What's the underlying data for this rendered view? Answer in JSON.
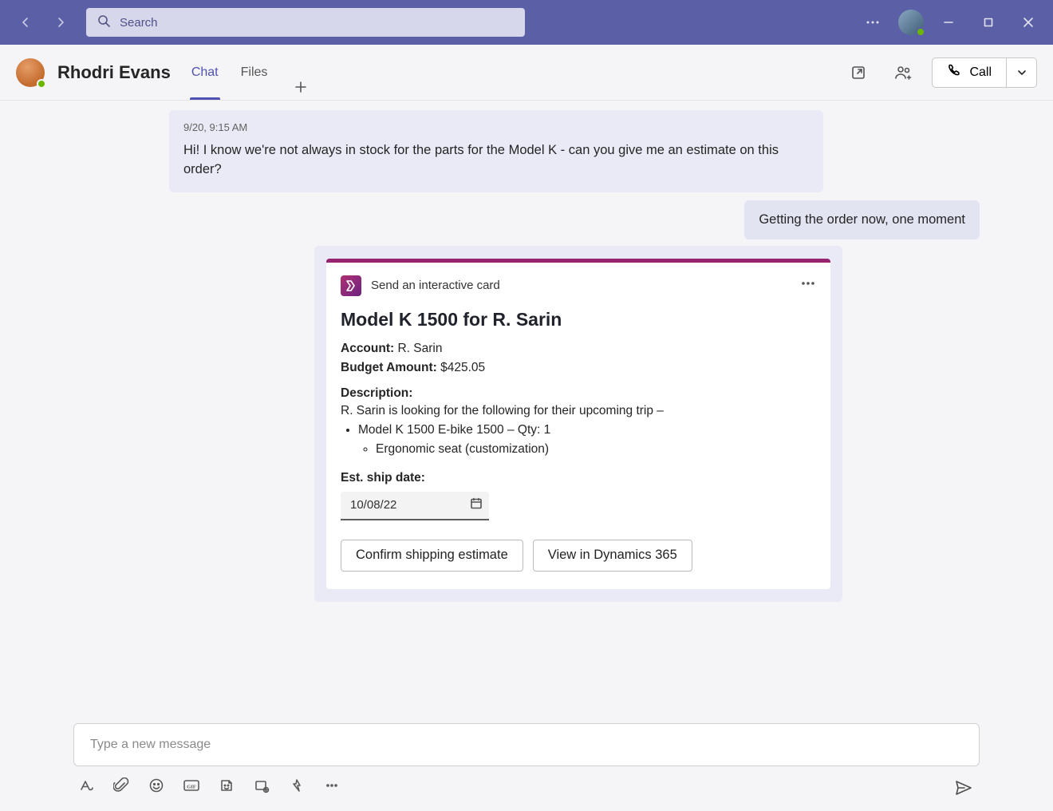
{
  "titlebar": {
    "search_placeholder": "Search"
  },
  "chat_header": {
    "name": "Rhodri Evans",
    "tabs": [
      {
        "label": "Chat",
        "active": true
      },
      {
        "label": "Files",
        "active": false
      }
    ],
    "call_label": "Call"
  },
  "messages": {
    "incoming": {
      "timestamp": "9/20, 9:15 AM",
      "text": "Hi! I know we're not always in stock for the parts for the Model K - can you give me an estimate on this order?"
    },
    "outgoing": {
      "text": "Getting the order now, one moment"
    }
  },
  "card": {
    "source_label": "Send an interactive card",
    "title": "Model K 1500 for R. Sarin",
    "account_label": "Account:",
    "account_value": "R. Sarin",
    "budget_label": "Budget Amount:",
    "budget_value": "$425.05",
    "description_label": "Description:",
    "description_body": "R. Sarin is looking for the following for their upcoming trip –",
    "items": [
      "Model K 1500 E-bike 1500 – Qty: 1"
    ],
    "subitems": [
      "Ergonomic seat (customization)"
    ],
    "ship_label": "Est. ship date:",
    "ship_value": "10/08/22",
    "action_confirm": "Confirm shipping estimate",
    "action_view": "View in Dynamics 365"
  },
  "compose": {
    "placeholder": "Type a new message"
  }
}
